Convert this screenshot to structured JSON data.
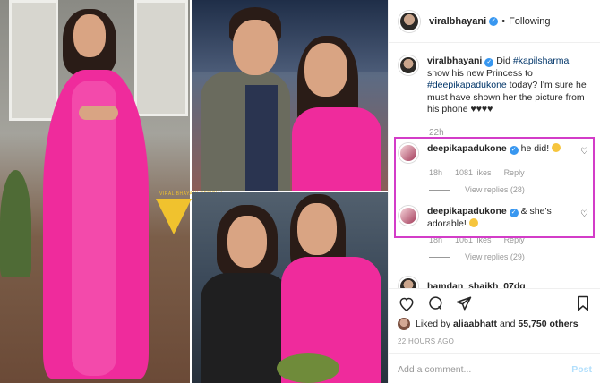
{
  "post": {
    "author": "viralbhayani",
    "follow_status": "Following",
    "caption_prefix": "Did ",
    "caption_tag1": "#kapilsharma",
    "caption_middle": " show his new Princess to ",
    "caption_tag2": "#deepikapadukone",
    "caption_suffix": " today? I'm sure he must have shown her the picture from his phone ♥♥♥♥",
    "caption_time": "22h"
  },
  "comments": [
    {
      "user": "deepikapadukone",
      "text": "he did!",
      "time": "18h",
      "likes": "1081 likes",
      "reply": "Reply",
      "view_replies": "View replies (28)"
    },
    {
      "user": "deepikapadukone",
      "text": "& she's adorable!",
      "time": "18h",
      "likes": "1061 likes",
      "reply": "Reply",
      "view_replies": "View replies (29)"
    }
  ],
  "next_comment_user": "hamdan_shaikh_07dq",
  "likes_summary": {
    "prefix": "Liked by ",
    "user": "aliaabhatt",
    "middle": " and ",
    "count": "55,750 others"
  },
  "timestamp": "22 HOURS AGO",
  "add_comment": {
    "placeholder": "Add a comment...",
    "post_label": "Post"
  },
  "watermark": "VIRAL BHAYANI OFFICIAL",
  "icons": [
    "heart-icon",
    "comment-icon",
    "share-icon",
    "bookmark-icon",
    "verified-icon",
    "more-icon"
  ],
  "colors": {
    "highlight": "#d33cc8",
    "link": "#003569",
    "muted": "#999999",
    "verified": "#3897f0",
    "post_disabled": "#b2dffc"
  }
}
